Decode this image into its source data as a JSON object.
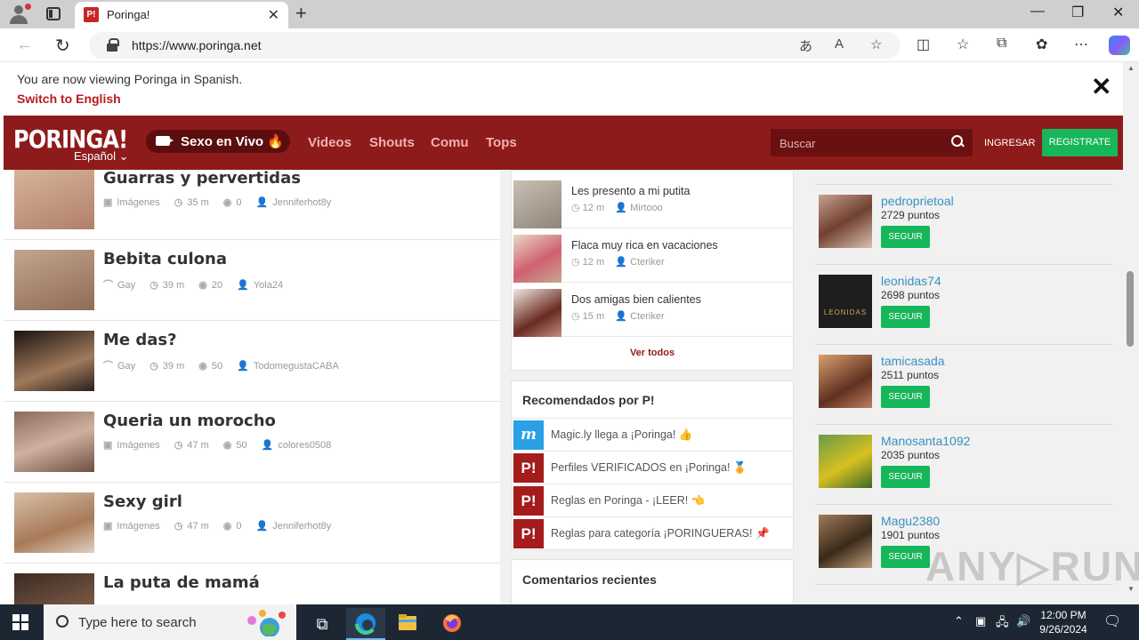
{
  "browser": {
    "tab_title": "Poringa!",
    "tab_favicon": "P!",
    "url": "https://www.poringa.net"
  },
  "banner": {
    "message": "You are now viewing Poringa in Spanish.",
    "switch_label": "Switch to English",
    "close_label": "✕"
  },
  "header": {
    "logo": "PORINGA!",
    "language": "Español",
    "live_label": "Sexo en Vivo 🔥",
    "nav": [
      "Videos",
      "Shouts",
      "Comu",
      "Tops"
    ],
    "search_placeholder": "Buscar",
    "login_label": "INGRESAR",
    "register_label": "REGISTRATE"
  },
  "posts": [
    {
      "title": "Guarras y pervertidas",
      "category": "Imágenes",
      "time": "35 m",
      "comments": "0",
      "author": "Jenniferhot8y"
    },
    {
      "title": "Bebita culona",
      "category": "Gay",
      "time": "39 m",
      "comments": "20",
      "author": "Yola24"
    },
    {
      "title": "Me das?",
      "category": "Gay",
      "time": "39 m",
      "comments": "50",
      "author": "TodomegustaCABA"
    },
    {
      "title": "Queria un morocho",
      "category": "Imágenes",
      "time": "47 m",
      "comments": "50",
      "author": "colores0508"
    },
    {
      "title": "Sexy girl",
      "category": "Imágenes",
      "time": "47 m",
      "comments": "0",
      "author": "Jenniferhot8y"
    },
    {
      "title": "La puta de mamá",
      "category": "",
      "time": "",
      "comments": "",
      "author": ""
    }
  ],
  "popular": {
    "items": [
      {
        "title": "Les presento a mi putita",
        "time": "12 m",
        "author": "Mirtooo"
      },
      {
        "title": "Flaca muy rica en vacaciones",
        "time": "12 m",
        "author": "Cteriker"
      },
      {
        "title": "Dos amigas bien calientes",
        "time": "15 m",
        "author": "Cteriker"
      }
    ],
    "see_all": "Ver todos"
  },
  "recommended": {
    "heading": "Recomendados por P!",
    "items": [
      {
        "icon": "m",
        "label": "Magic.ly llega a ¡Poringa! 👍"
      },
      {
        "icon": "P!",
        "label": "Perfiles VERIFICADOS en ¡Poringa! 🏅"
      },
      {
        "icon": "P!",
        "label": "Reglas en Poringa - ¡LEER! 👈"
      },
      {
        "icon": "P!",
        "label": "Reglas para categoría ¡PORINGUERAS! 📌"
      }
    ]
  },
  "comments": {
    "heading": "Comentarios recientes"
  },
  "users": {
    "follow_label": "SEGUIR",
    "items": [
      {
        "name": "pedroprietoal",
        "points": "2729 puntos"
      },
      {
        "name": "leonidas74",
        "points": "2698 puntos",
        "avatar_text": "LEONIDAS"
      },
      {
        "name": "tamicasada",
        "points": "2511 puntos"
      },
      {
        "name": "Manosanta1092",
        "points": "2035 puntos"
      },
      {
        "name": "Magu2380",
        "points": "1901 puntos"
      }
    ]
  },
  "watermark": "ANY▷RUN",
  "taskbar": {
    "search_placeholder": "Type here to search",
    "time": "12:00 PM",
    "date": "9/26/2024"
  },
  "colors": {
    "brand": "#8e1b1b",
    "accent_green": "#17b65a",
    "link_blue": "#3b8fc4"
  }
}
